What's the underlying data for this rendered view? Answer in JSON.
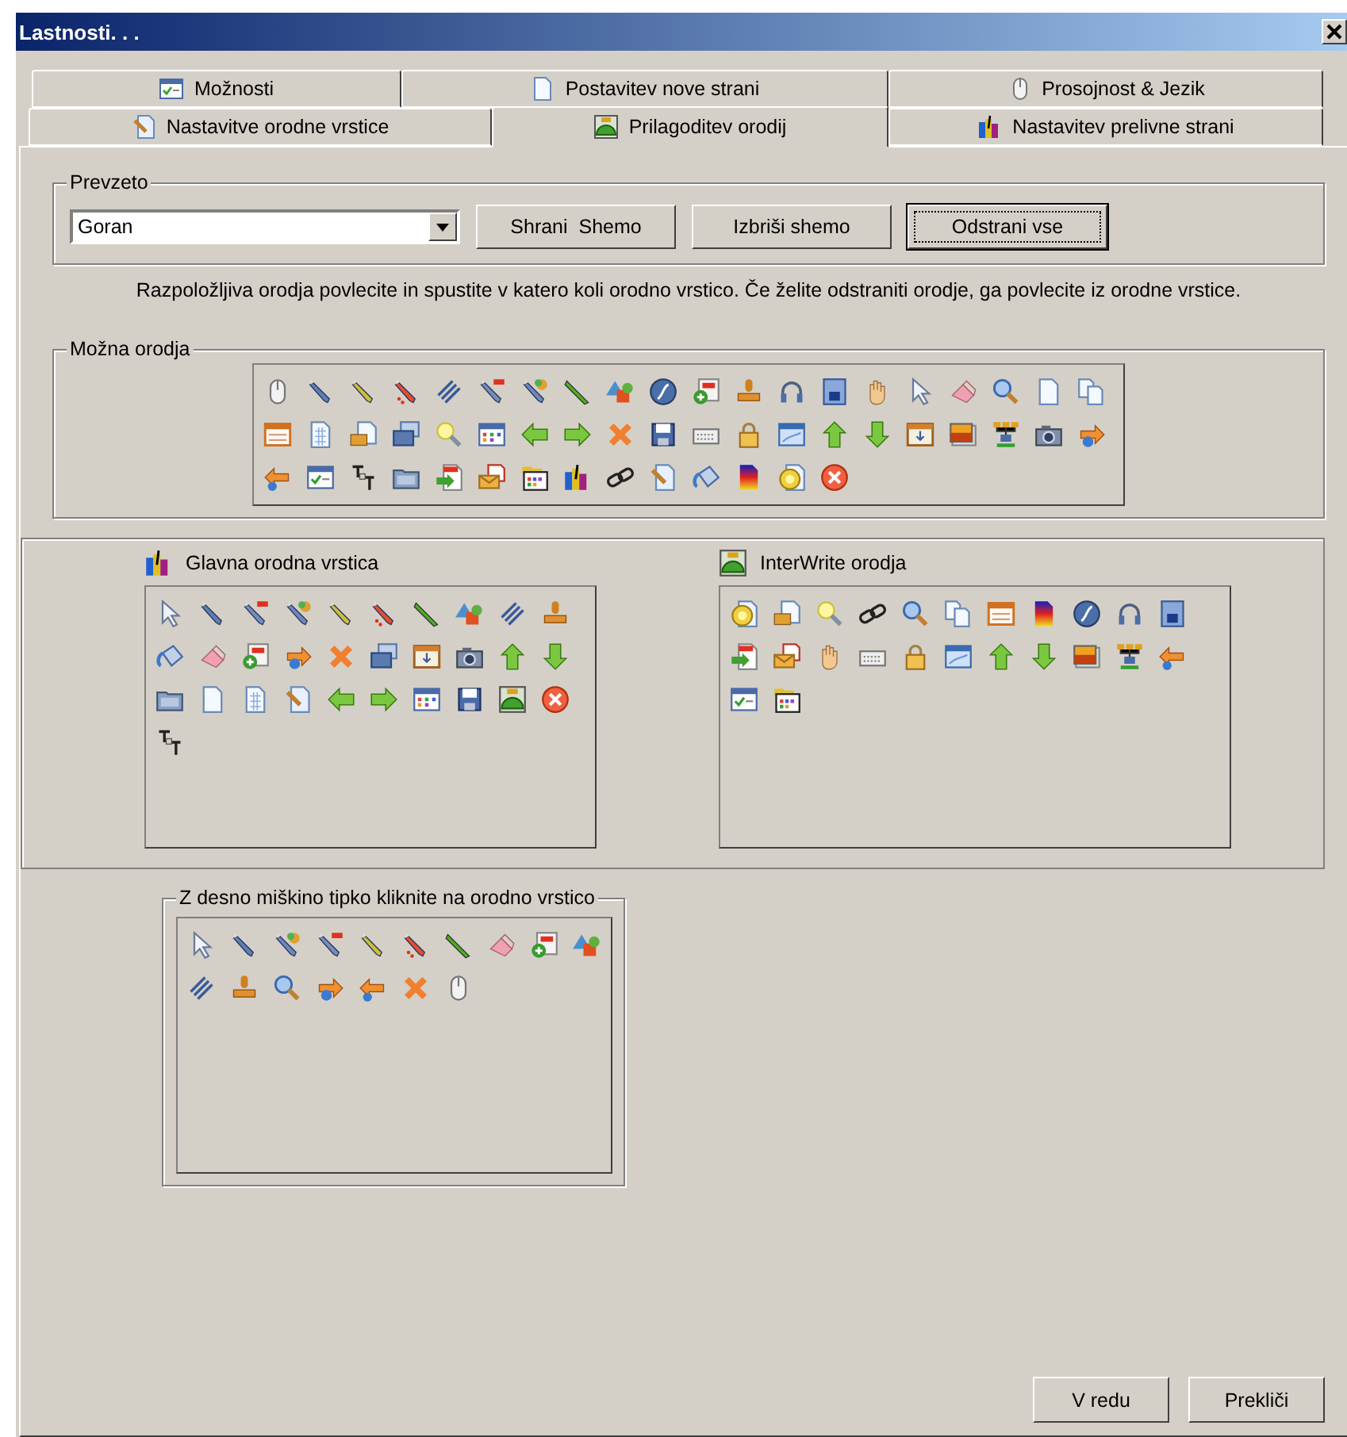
{
  "window": {
    "title": "Lastnosti. . ."
  },
  "tab_rows": [
    {
      "tabs": [
        {
          "label": "Možnosti",
          "selected": false
        },
        {
          "label": "Postavitev nove strani",
          "selected": false
        },
        {
          "label": "Prosojnost & Jezik",
          "selected": false
        }
      ]
    },
    {
      "tabs": [
        {
          "label": "Nastavitve orodne vrstice",
          "selected": false
        },
        {
          "label": "Prilagoditev orodij",
          "selected": true
        },
        {
          "label": "Nastavitev prelivne strani",
          "selected": false
        }
      ]
    }
  ],
  "preset": {
    "legend": "Prevzeto",
    "value": "Goran",
    "buttons": [
      {
        "label": "Shrani  Shemo",
        "focused": false
      },
      {
        "label": "Izbriši shemo",
        "focused": false
      },
      {
        "label": "Odstrani vse",
        "focused": true
      }
    ]
  },
  "hint": "Razpoložljiva orodja povlecite in spustite v katero koli orodno vrstico.  Če želite odstraniti orodje, ga povlecite iz orodne vrstice.",
  "available": {
    "legend": "Možna orodja"
  },
  "toolbars": [
    {
      "title": "Glavna orodna vrstica"
    },
    {
      "title": "InterWrite orodja"
    }
  ],
  "context_toolbar": {
    "legend": "Z desno miškino tipko kliknite na orodno vrstico"
  },
  "footer_buttons": [
    {
      "label": "V redu"
    },
    {
      "label": "Prekliči"
    }
  ]
}
